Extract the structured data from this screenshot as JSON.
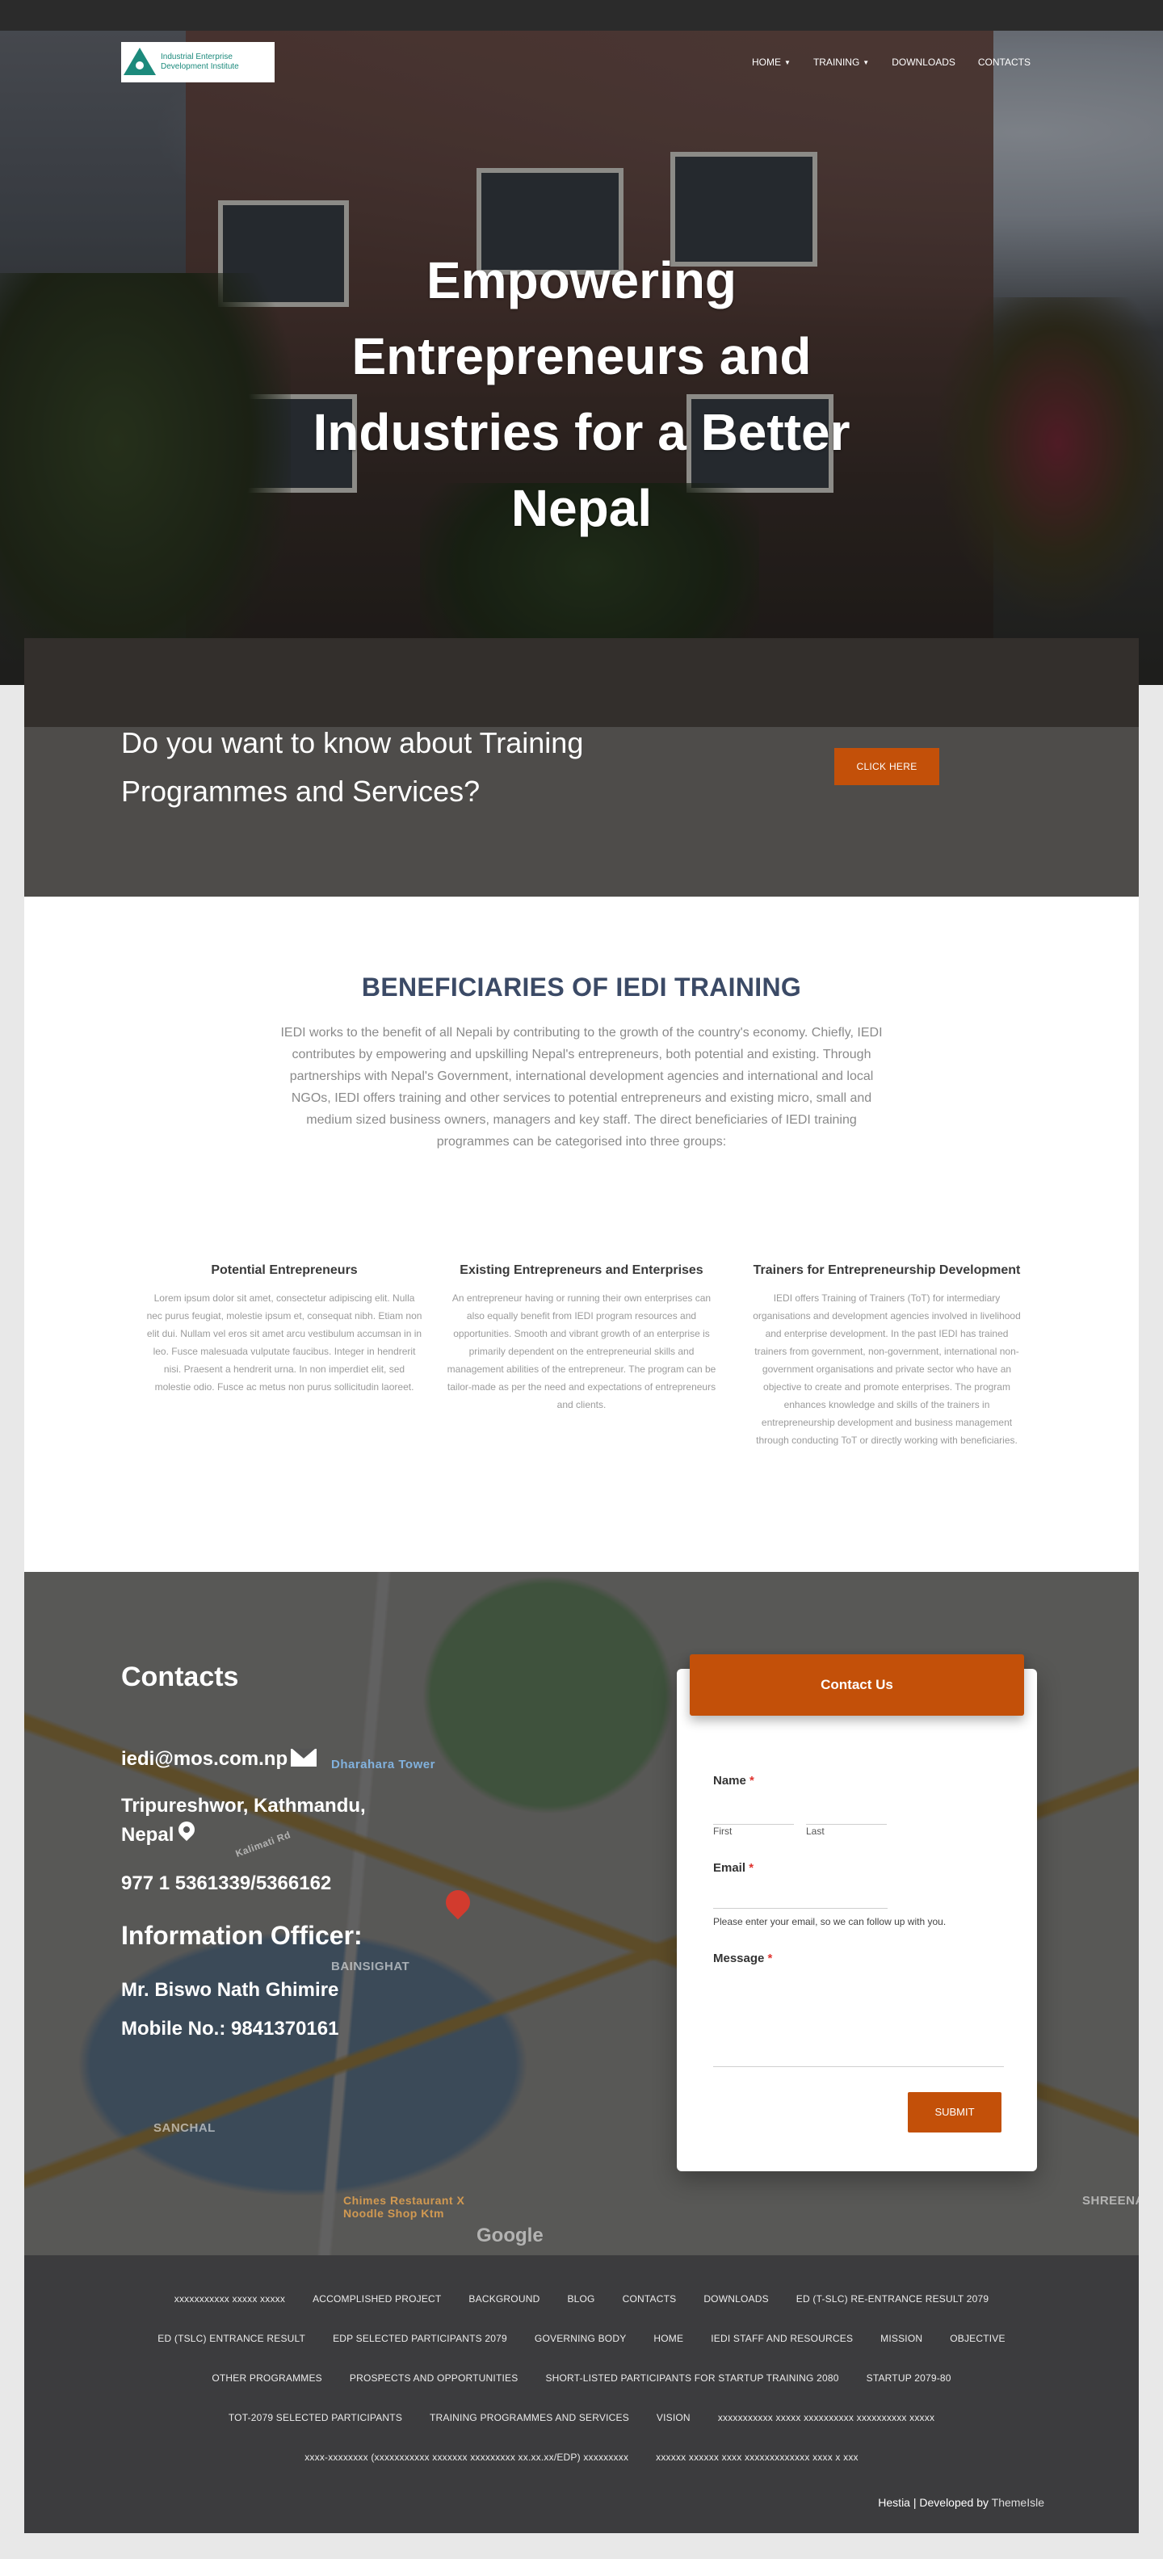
{
  "header": {
    "logo_text": "Industrial Enterprise Development Institute",
    "nav": [
      {
        "label": "HOME",
        "dropdown": true
      },
      {
        "label": "TRAINING",
        "dropdown": true
      },
      {
        "label": "DOWNLOADS",
        "dropdown": false
      },
      {
        "label": "CONTACTS",
        "dropdown": false
      }
    ]
  },
  "hero": {
    "title_lines": [
      "Empowering",
      "Entrepreneurs and",
      "Industries for a Better",
      "Nepal"
    ]
  },
  "cta": {
    "title": "Do you want to know about Training Programmes and Services?",
    "button": "CLICK HERE"
  },
  "beneficiaries": {
    "heading": "BENEFICIARIES OF IEDI TRAINING",
    "intro": "IEDI works to the benefit of all Nepali by contributing to the growth of the country's economy. Chiefly, IEDI contributes by empowering and upskilling Nepal's entrepreneurs, both potential and existing. Through partnerships with Nepal's Government, international development agencies and international and local NGOs, IEDI offers training and other services to potential entrepreneurs and existing micro, small and medium sized business owners, managers and key staff. The direct beneficiaries of IEDI training programmes can be categorised into three groups:",
    "columns": [
      {
        "title": "Potential Entrepreneurs",
        "text": "Lorem ipsum dolor sit amet, consectetur adipiscing elit. Nulla nec purus feugiat, molestie ipsum et, consequat nibh. Etiam non elit dui. Nullam vel eros sit amet arcu vestibulum accumsan in in leo. Fusce malesuada vulputate faucibus. Integer in hendrerit nisi. Praesent a hendrerit urna. In non imperdiet elit, sed molestie odio. Fusce ac metus non purus sollicitudin laoreet."
      },
      {
        "title": "Existing Entrepreneurs and Enterprises",
        "text": "An entrepreneur having or running their own enterprises can also equally benefit from IEDI program resources and opportunities. Smooth and vibrant growth of an enterprise is primarily dependent on the entrepreneurial skills and management abilities of the entrepreneur. The program can be tailor-made as per the need and expectations of entrepreneurs and clients."
      },
      {
        "title": "Trainers for Entrepreneurship Development",
        "text": "IEDI offers Training of Trainers (ToT) for intermediary organisations and development agencies involved in livelihood and enterprise development. In the past IEDI has trained trainers from government, non-government, international non-government organisations and private sector who have an objective to create and promote enterprises. The program enhances knowledge and skills of the trainers in entrepreneurship development and business management through conducting ToT or directly working with beneficiaries."
      }
    ]
  },
  "contacts": {
    "heading": "Contacts",
    "email": "iedi@mos.com.np",
    "address_line1": "Tripureshwor, Kathmandu,",
    "address_line2": "Nepal",
    "phone": "977 1 5361339/5366162",
    "info_heading": "Information Officer:",
    "officer": "Mr. Biswo Nath Ghimire",
    "mobile": "Mobile No.: 9841370161",
    "map_labels": {
      "tower": "Dharahara Tower",
      "bainsighat": "BAINSIGHAT",
      "sanchal": "SANCHAL",
      "shreenagar": "SHREENAGA",
      "restaurant": "Chimes Restaurant X Noodle Shop Ktm",
      "kalimati": "Kalimati Rd",
      "google": "Google"
    }
  },
  "form": {
    "title": "Contact Us",
    "name_label": "Name",
    "first_label": "First",
    "last_label": "Last",
    "email_label": "Email",
    "email_note": "Please enter your email, so we can follow up with you.",
    "message_label": "Message",
    "required_mark": "*",
    "submit": "SUBMIT"
  },
  "footer": {
    "rows": [
      [
        "xxxxxxxxxxx xxxxx xxxxx",
        "ACCOMPLISHED PROJECT",
        "BACKGROUND",
        "BLOG",
        "CONTACTS",
        "DOWNLOADS",
        "ED (T-SLC) RE-ENTRANCE RESULT 2079"
      ],
      [
        "ED (TSLC) ENTRANCE RESULT",
        "EDP SELECTED PARTICIPANTS 2079",
        "GOVERNING BODY",
        "HOME",
        "IEDI STAFF AND RESOURCES",
        "MISSION",
        "OBJECTIVE"
      ],
      [
        "OTHER PROGRAMMES",
        "PROSPECTS AND OPPORTUNITIES",
        "SHORT-LISTED PARTICIPANTS FOR STARTUP TRAINING 2080",
        "STARTUP 2079-80"
      ],
      [
        "TOT-2079 SELECTED PARTICIPANTS",
        "TRAINING PROGRAMMES AND SERVICES",
        "VISION",
        "xxxxxxxxxxx xxxxx xxxxxxxxxx xxxxxxxxxx xxxxx"
      ],
      [
        "xxxx-xxxxxxxx (xxxxxxxxxxx xxxxxxx xxxxxxxxx xx.xx.xx/EDP) xxxxxxxxx",
        "xxxxxx xxxxxx xxxx xxxxxxxxxxxxx xxxx x xxx"
      ]
    ],
    "credits_prefix": "Hestia | Developed by ",
    "credits_brand": "ThemeIsle"
  }
}
